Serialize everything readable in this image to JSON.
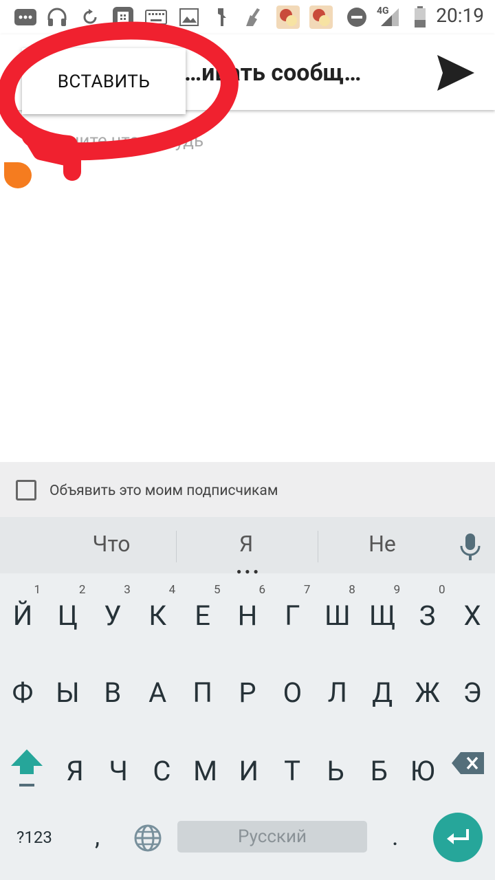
{
  "status_bar": {
    "time": "20:19",
    "network": "4G"
  },
  "header": {
    "title": "…ивать сообщ…",
    "paste_label": "ВСТАВИТЬ"
  },
  "editor": {
    "placeholder": "…ишите что-нибудь"
  },
  "announce": {
    "label": "Объявить это моим подписчикам",
    "checked": false
  },
  "keyboard": {
    "suggestions": [
      "Что",
      "Я",
      "Не"
    ],
    "row1": [
      {
        "k": "Й",
        "h": "1"
      },
      {
        "k": "Ц",
        "h": "2"
      },
      {
        "k": "У",
        "h": "3"
      },
      {
        "k": "К",
        "h": "4"
      },
      {
        "k": "Е",
        "h": "5"
      },
      {
        "k": "Н",
        "h": "6"
      },
      {
        "k": "Г",
        "h": "7"
      },
      {
        "k": "Ш",
        "h": "8"
      },
      {
        "k": "Щ",
        "h": "9"
      },
      {
        "k": "З",
        "h": "0"
      },
      {
        "k": "Х",
        "h": ""
      }
    ],
    "row2": [
      "Ф",
      "Ы",
      "В",
      "А",
      "П",
      "Р",
      "О",
      "Л",
      "Д",
      "Ж",
      "Э"
    ],
    "row3": [
      "Я",
      "Ч",
      "С",
      "М",
      "И",
      "Т",
      "Ь",
      "Б",
      "Ю"
    ],
    "symbols_label": "?123",
    "comma": ",",
    "period": ".",
    "space_label": "Русский"
  },
  "colors": {
    "accent": "#26a69a",
    "handle": "#f57c1f",
    "annotation": "#f0212f"
  }
}
